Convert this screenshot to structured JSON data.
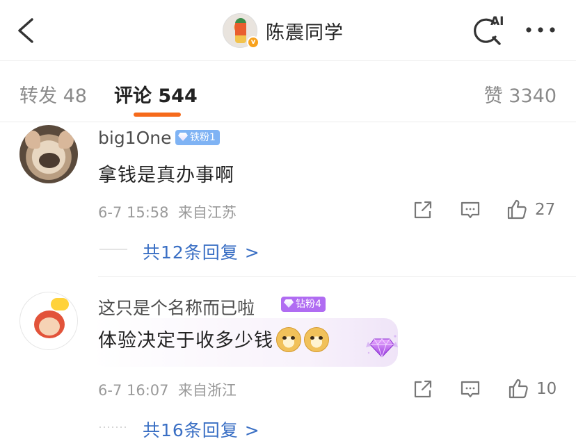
{
  "header": {
    "author_name": "陈震同学",
    "ai_label": "AI"
  },
  "tabs": {
    "repost": "转发 48",
    "comments": "评论 544",
    "likes": "赞 3340"
  },
  "comments": [
    {
      "username": "big1One",
      "badge": "铁粉1",
      "text": "拿钱是真办事啊",
      "time": "6-7 15:58",
      "location": "来自江苏",
      "likes": "27",
      "replies": "共12条回复 >"
    },
    {
      "username": "这只是个名称而已啦",
      "badge": "钻粉4",
      "text": "体验决定于收多少钱",
      "time": "6-7 16:07",
      "location": "来自浙江",
      "likes": "10",
      "replies": "共16条回复 >"
    }
  ],
  "colors": {
    "accent": "#f66a1b",
    "link": "#3a6fc4",
    "iron_badge": "#7fb3f4",
    "diamond_badge": "#b06cf2"
  },
  "icons": [
    "back-icon",
    "ai-search-icon",
    "more-icon",
    "repost-icon",
    "comment-icon",
    "like-icon",
    "doge-emoji",
    "diamond-icon"
  ]
}
